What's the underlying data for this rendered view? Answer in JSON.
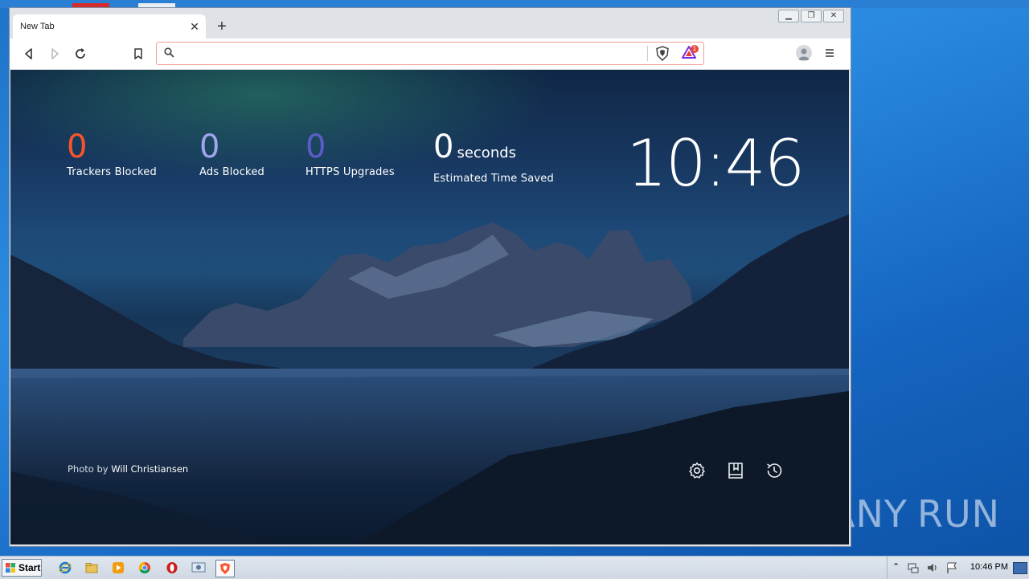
{
  "browser": {
    "tab_title": "New Tab",
    "address_placeholder": "",
    "rewards_badge": "1"
  },
  "stats": {
    "trackers": {
      "value": "0",
      "label": "Trackers Blocked",
      "color": "#fb542b"
    },
    "ads": {
      "value": "0",
      "label": "Ads Blocked",
      "color": "#a0a5eb"
    },
    "https": {
      "value": "0",
      "label": "HTTPS Upgrades",
      "color": "#5b5cc9"
    },
    "time": {
      "value": "0",
      "unit": "seconds",
      "label": "Estimated Time Saved"
    }
  },
  "clock": "10:46",
  "photo_credit": {
    "prefix": "Photo by",
    "author": "Will Christiansen"
  },
  "ntp_icons": [
    "gear-icon",
    "bookmarks-icon",
    "history-icon"
  ],
  "taskbar": {
    "start_label": "Start",
    "items": [
      "ie-icon",
      "explorer-icon",
      "media-player-icon",
      "chrome-icon",
      "opera-icon",
      "control-panel-icon",
      "brave-icon"
    ],
    "time": "10:46 PM"
  },
  "watermark": {
    "left": "ANY",
    "right": "RUN"
  }
}
